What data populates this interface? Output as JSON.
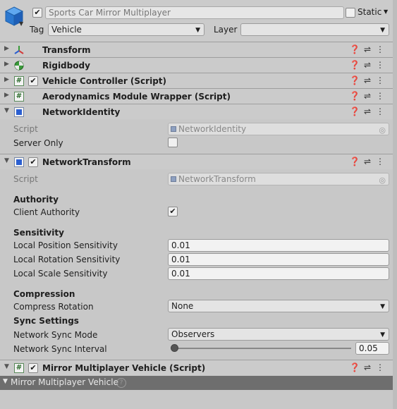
{
  "gameobject": {
    "active_check": "✔",
    "name": "Sports Car Mirror Multiplayer",
    "static_label": "Static",
    "tag_label": "Tag",
    "tag_value": "Vehicle",
    "layer_label": "Layer",
    "layer_value": ""
  },
  "components": {
    "transform": {
      "title": "Transform"
    },
    "rigidbody": {
      "title": "Rigidbody"
    },
    "vehicle_controller": {
      "title": "Vehicle Controller (Script)",
      "check": "✔"
    },
    "aero": {
      "title": "Aerodynamics Module Wrapper (Script)"
    },
    "network_identity": {
      "title": "NetworkIdentity",
      "script_label": "Script",
      "script_value": "NetworkIdentity",
      "server_only_label": "Server Only"
    },
    "network_transform": {
      "title": "NetworkTransform",
      "check": "✔",
      "script_label": "Script",
      "script_value": "NetworkTransform",
      "authority_header": "Authority",
      "client_authority_label": "Client Authority",
      "client_authority_check": "✔",
      "sensitivity_header": "Sensitivity",
      "local_position_label": "Local Position Sensitivity",
      "local_position_value": "0.01",
      "local_rotation_label": "Local Rotation Sensitivity",
      "local_rotation_value": "0.01",
      "local_scale_label": "Local Scale Sensitivity",
      "local_scale_value": "0.01",
      "compression_header": "Compression",
      "compress_rotation_label": "Compress Rotation",
      "compress_rotation_value": "None",
      "sync_header": "Sync Settings",
      "sync_mode_label": "Network Sync Mode",
      "sync_mode_value": "Observers",
      "sync_interval_label": "Network Sync Interval",
      "sync_interval_value": "0.05"
    },
    "mirror_vehicle": {
      "title": "Mirror Multiplayer Vehicle (Script)",
      "check": "✔"
    }
  },
  "footer": {
    "label": "Mirror Multiplayer Vehicle",
    "help": "?"
  },
  "icons": {
    "help": "❓",
    "settings": "⇌",
    "menu": "⋮",
    "fold_right": "▶",
    "fold_down": "▼",
    "dropdown": "▼"
  },
  "colors": {
    "network_blue": "#2b5fd1",
    "rigidbody_green": "#3a9a3a"
  }
}
